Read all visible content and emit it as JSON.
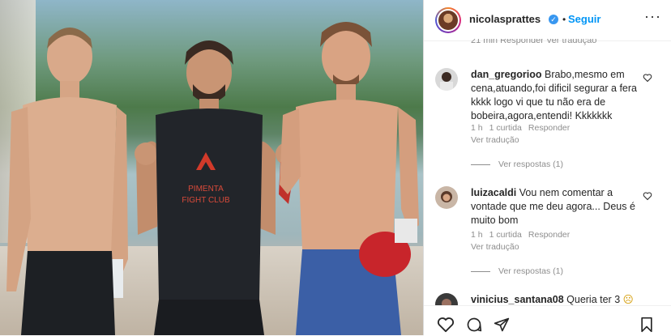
{
  "post": {
    "author": "nicolasprattes",
    "follow_label": "Seguir",
    "dot": "•",
    "more_label": "···",
    "time_meta": "21 min   Responder   Ver tradução",
    "shirt_brand_line1": "PIMENTA",
    "shirt_brand_line2": "FIGHT CLUB"
  },
  "comments": [
    {
      "username": "dan_gregorioo",
      "text": "Brabo,mesmo em cena,atuando,foi dificil segurar a fera kkkk logo vi que tu não era de bobeira,agora,entendi! Kkkkkkk",
      "time": "1 h",
      "likes": "1 curtida",
      "reply": "Responder",
      "translate": "Ver tradução",
      "replies": "Ver respostas (1)"
    },
    {
      "username": "luizacaldi",
      "text": "Vou nem comentar a vontade que me deu agora... Deus é muito bom",
      "time": "1 h",
      "likes": "1 curtida",
      "reply": "Responder",
      "translate": "Ver tradução",
      "replies": "Ver respostas (1)"
    },
    {
      "username": "vinicius_santana08",
      "text": "Queria ter 3",
      "emoji": "☹"
    }
  ]
}
